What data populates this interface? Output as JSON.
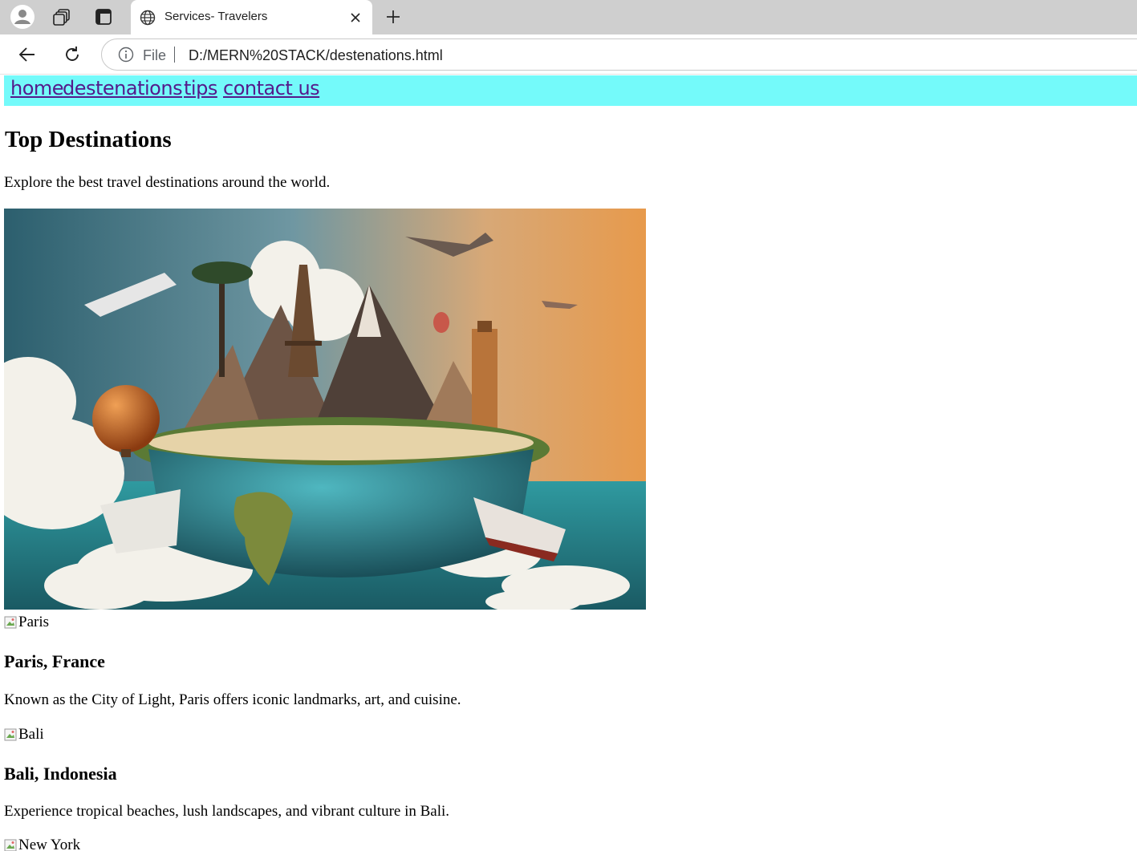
{
  "browser": {
    "tab_title": "Services- Travelers",
    "address_scheme_label": "File",
    "url": "D:/MERN%20STACK/destenations.html"
  },
  "nav": {
    "links": [
      "home",
      "destenations",
      "tips",
      "contact us"
    ],
    "background": "#74fafa",
    "link_color": "#551a8b"
  },
  "page": {
    "heading": "Top Destinations",
    "intro": "Explore the best travel destinations around the world.",
    "hero_image": "world travel collage with Eiffel Tower, mountains, globe, ships, planes and balloons",
    "destinations": [
      {
        "image_alt": "Paris",
        "title": "Paris, France",
        "description": "Known as the City of Light, Paris offers iconic landmarks, art, and cuisine."
      },
      {
        "image_alt": "Bali",
        "title": "Bali, Indonesia",
        "description": "Experience tropical beaches, lush landscapes, and vibrant culture in Bali."
      },
      {
        "image_alt": "New York"
      }
    ]
  },
  "icons": [
    "profile-icon",
    "workspaces-icon",
    "tab-actions-icon",
    "globe-icon",
    "close-icon",
    "new-tab-icon",
    "back-arrow-icon",
    "reload-icon",
    "info-icon",
    "broken-image-icon"
  ]
}
